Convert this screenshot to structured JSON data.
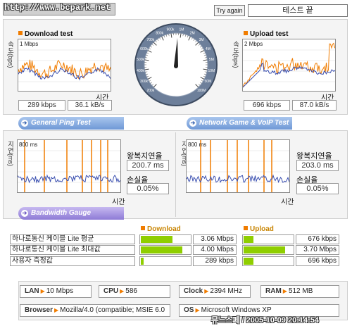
{
  "header": {
    "logo_text": "http://www.bcpark.net",
    "try_again_label": "Try again",
    "status_text": "테스트 끝"
  },
  "colors": {
    "accent": "#f07c00",
    "graph_line": "#3a4fb0",
    "bar": "#8fce00",
    "tab": "#6f98d6"
  },
  "download": {
    "title": "Download test",
    "ylabel": "속도(bps)",
    "scale": "1 Mbps",
    "xlabel": "시간",
    "kbps": "289 kbps",
    "kBs": "36.1 kB/s"
  },
  "upload": {
    "title": "Upload test",
    "ylabel": "속도(bps)",
    "scale": "2 Mbps",
    "xlabel": "시간",
    "kbps": "696 kbps",
    "kBs": "87.0 kB/s"
  },
  "gauge": {
    "labels": [
      "200k",
      "300k",
      "400k",
      "500k",
      "600k",
      "700k",
      "800k",
      "900k",
      "1M",
      "2M",
      "3M",
      "4M",
      "5M",
      "10M",
      "50M",
      "100M"
    ]
  },
  "ping": {
    "tab_label": "General Ping Test",
    "ylabel": "지연(ms)",
    "scale": "800 ms",
    "xlabel": "시간",
    "rtt_label": "왕복지연율",
    "rtt_value": "200.7 ms",
    "loss_label": "손실율",
    "loss_value": "0.05%"
  },
  "game": {
    "tab_label": "Network Game & VoIP Test",
    "ylabel": "지연(ms)",
    "scale": "800 ms",
    "xlabel": "시간",
    "rtt_label": "왕복지연율",
    "rtt_value": "203.0 ms",
    "loss_label": "손실율",
    "loss_value": "0.05%"
  },
  "bandwidth": {
    "tab_label": "Bandwidth Gauge",
    "download_header": "Download",
    "upload_header": "Upload",
    "rows": [
      {
        "label": "하나로통신 케이블 Lite 평균",
        "down": "3.06 Mbps",
        "down_frac": 0.62,
        "up": "676 kbps",
        "up_frac": 0.2
      },
      {
        "label": "하나로통신 케이블 Lite 최대값",
        "down": "4.00 Mbps",
        "down_frac": 0.82,
        "up": "3.70 Mbps",
        "up_frac": 0.82
      },
      {
        "label": "사용자 측정값",
        "down": "289 kbps",
        "down_frac": 0.05,
        "up": "696 kbps",
        "up_frac": 0.2
      }
    ]
  },
  "sysinfo": {
    "lan_label": "LAN",
    "lan_value": "10 Mbps",
    "cpu_label": "CPU",
    "cpu_value": "586",
    "clock_label": "Clock",
    "clock_value": "2394 MHz",
    "ram_label": "RAM",
    "ram_value": "512 MB",
    "browser_label": "Browser",
    "browser_value": "Mozilla/4.0 (compatible; MSIE 6.0",
    "os_label": "OS",
    "os_value": "Microsoft Windows XP"
  },
  "watermark": "뮤느스페 / 2005-10-09 20:14:54"
}
